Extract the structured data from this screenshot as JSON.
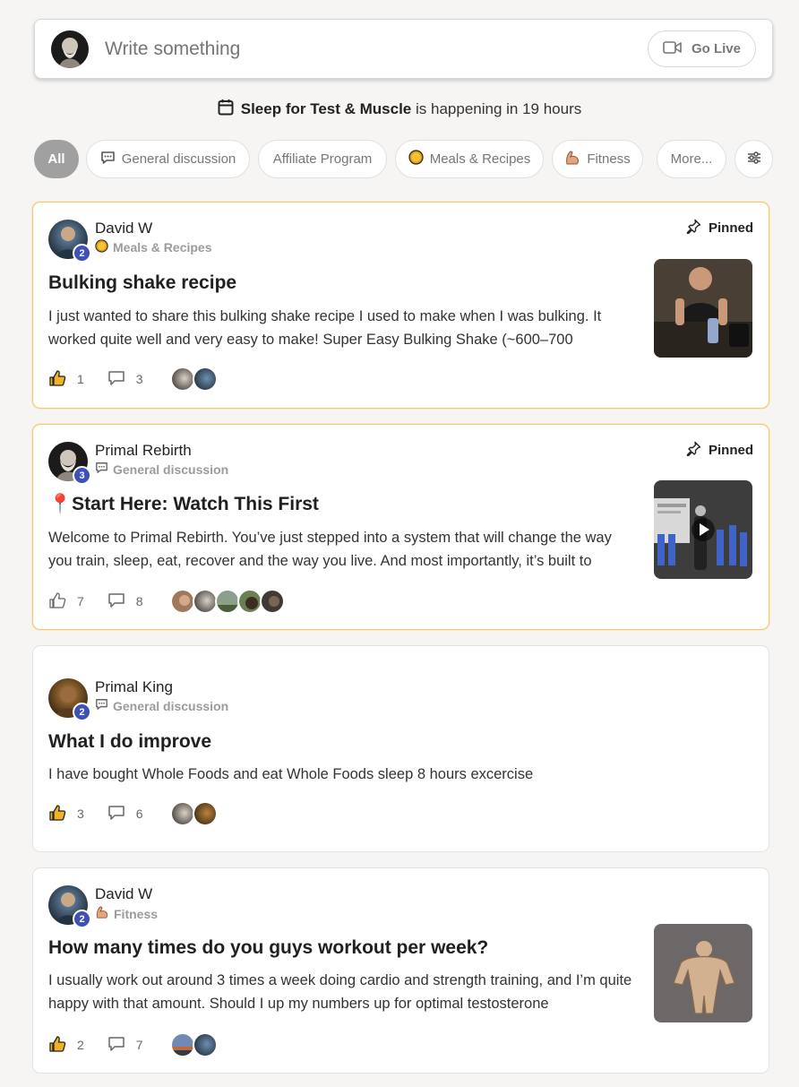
{
  "composer": {
    "placeholder": "Write something",
    "golive_label": "Go Live"
  },
  "event": {
    "name": "Sleep for Test & Muscle",
    "suffix": "is happening in 19 hours"
  },
  "filters": [
    {
      "label": "All",
      "icon": ""
    },
    {
      "label": "General discussion",
      "icon": "speech-bubble-icon"
    },
    {
      "label": "Affiliate Program",
      "icon": ""
    },
    {
      "label": "Meals & Recipes",
      "icon": "food-icon"
    },
    {
      "label": "Fitness",
      "icon": "flexed-biceps-icon"
    },
    {
      "label": "More...",
      "icon": ""
    }
  ],
  "posts": [
    {
      "author": "David W",
      "level": "2",
      "category": "Meals & Recipes",
      "category_icon": "food-icon",
      "pinned": true,
      "pinned_label": "Pinned",
      "title": "Bulking shake recipe",
      "body": "I just wanted to share this bulking shake recipe I used to make when I was bulking. It worked quite well and very easy to make! Super Easy Bulking Shake (~600–700",
      "likes": "1",
      "comments": "3",
      "liked": true
    },
    {
      "author": "Primal Rebirth",
      "level": "3",
      "category": "General discussion",
      "category_icon": "speech-bubble-icon",
      "pinned": true,
      "pinned_label": "Pinned",
      "title_emoji": "📍",
      "title": "Start Here: Watch This First",
      "body": "Welcome to Primal Rebirth. You’ve just stepped into a system that will change the way you train, sleep, eat, recover and the way you live. And most importantly, it’s built to",
      "likes": "7",
      "comments": "8",
      "liked": false
    },
    {
      "author": "Primal King",
      "level": "2",
      "category": "General discussion",
      "category_icon": "speech-bubble-icon",
      "pinned": false,
      "title": "What I do improve",
      "body": "I have bought Whole Foods and eat Whole Foods sleep 8 hours excercise",
      "likes": "3",
      "comments": "6",
      "liked": true
    },
    {
      "author": "David W",
      "level": "2",
      "category": "Fitness",
      "category_icon": "flexed-biceps-icon",
      "pinned": false,
      "title": "How many times do you guys workout per week?",
      "body": "I usually work out around 3 times a week doing cardio and strength training, and I’m quite happy with that amount. Should I up my numbers up for optimal testosterone",
      "likes": "2",
      "comments": "7",
      "liked": true
    }
  ],
  "colors": {
    "pinned_border": "#f4c86c",
    "level_badge": "#3f51b5",
    "active_chip": "#a0a0a0",
    "like_active": "#f2b227"
  }
}
